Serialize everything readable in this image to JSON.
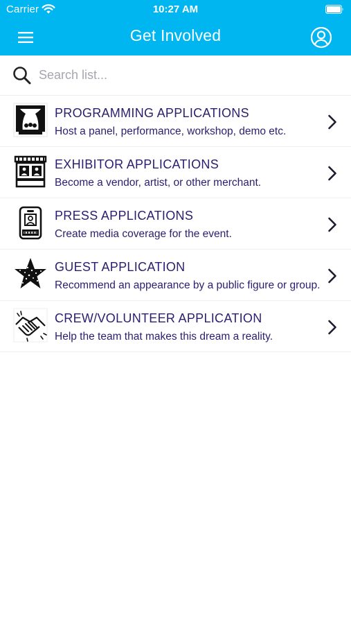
{
  "status_bar": {
    "carrier": "Carrier",
    "time": "10:27 AM",
    "icons": [
      "wifi-icon",
      "battery-icon"
    ]
  },
  "nav": {
    "title": "Get Involved",
    "left_icon": "menu-icon",
    "right_icon": "profile-icon"
  },
  "search": {
    "placeholder": "Search list...",
    "value": "",
    "icon": "search-icon"
  },
  "colors": {
    "header_bg": "#00b6f1",
    "header_text": "#ffffff",
    "item_text": "#2a1e6e",
    "placeholder": "#a6a6b0"
  },
  "items": [
    {
      "title": "PROGRAMMING APPLICATIONS",
      "subtitle": "Host a panel, performance, workshop, demo etc.",
      "icon": "stage-icon"
    },
    {
      "title": "EXHIBITOR APPLICATIONS",
      "subtitle": "Become a vendor, artist, or other merchant.",
      "icon": "storefront-icon"
    },
    {
      "title": "PRESS APPLICATIONS",
      "subtitle": "Create media coverage for the event.",
      "icon": "press-badge-icon"
    },
    {
      "title": "GUEST APPLICATION",
      "subtitle": "Recommend an appearance by a public figure or group.",
      "icon": "star-icon"
    },
    {
      "title": "CREW/VOLUNTEER APPLICATION",
      "subtitle": "Help the team that makes this dream a reality.",
      "icon": "handshake-icon"
    }
  ]
}
